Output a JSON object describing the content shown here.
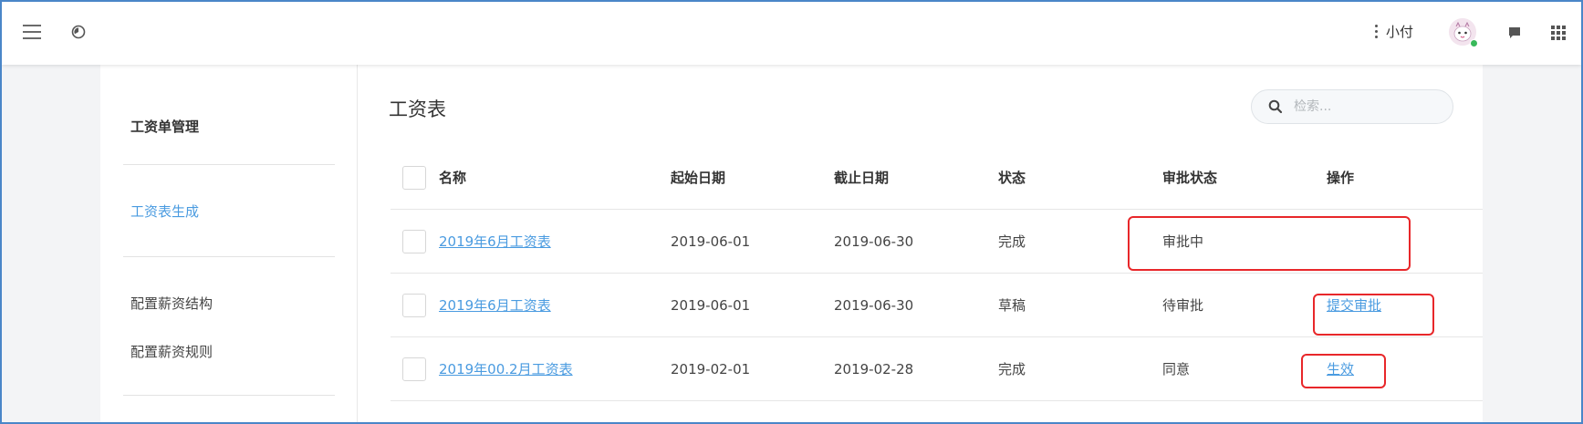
{
  "topbar": {
    "icons": [
      "menu-icon",
      "clock-icon",
      "more-vertical-icon",
      "chat-icon",
      "apps-grid-icon"
    ],
    "user_name": "小付"
  },
  "sidebar": {
    "title": "工资单管理",
    "active_item": "工资表生成",
    "items": [
      "配置薪资结构",
      "配置薪资规则"
    ]
  },
  "main": {
    "title": "工资表",
    "search": {
      "placeholder": "检索..."
    },
    "table": {
      "columns": [
        "名称",
        "起始日期",
        "截止日期",
        "状态",
        "审批状态",
        "操作"
      ],
      "rows": [
        {
          "name": "2019年6月工资表",
          "start": "2019-06-01",
          "end": "2019-06-30",
          "status": "完成",
          "approval": "审批中",
          "action": ""
        },
        {
          "name": "2019年6月工资表",
          "start": "2019-06-01",
          "end": "2019-06-30",
          "status": "草稿",
          "approval": "待审批",
          "action": "提交审批"
        },
        {
          "name": "2019年00.2月工资表",
          "start": "2019-02-01",
          "end": "2019-02-28",
          "status": "完成",
          "approval": "同意",
          "action": "生效"
        }
      ]
    }
  },
  "colors": {
    "accent": "#4a9be0",
    "highlight": "#e8272a",
    "frame": "#4a86c8"
  }
}
